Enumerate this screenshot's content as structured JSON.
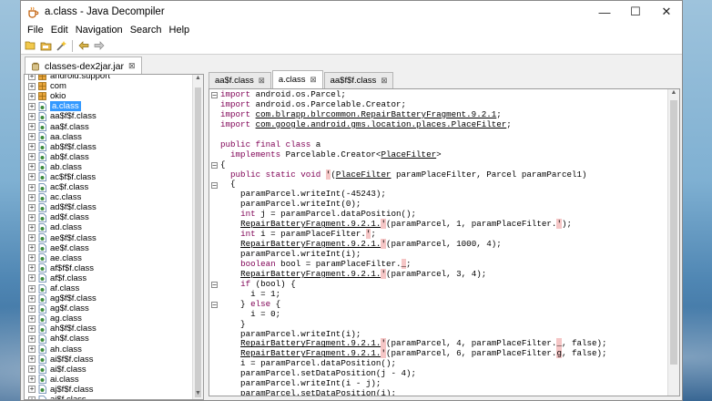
{
  "window": {
    "title": "a.class - Java Decompiler",
    "controls": {
      "minimize": "—",
      "maximize": "☐",
      "close": "✕"
    }
  },
  "menu": [
    "File",
    "Edit",
    "Navigation",
    "Search",
    "Help"
  ],
  "toolbar": {
    "icons": [
      "open-file-icon",
      "save-icon",
      "wand-icon",
      "back-arrow-icon",
      "forward-arrow-icon"
    ]
  },
  "file_tab": {
    "label": "classes-dex2jar.jar",
    "close": "⊠"
  },
  "tree": {
    "items": [
      {
        "label": "android.support",
        "type": "package"
      },
      {
        "label": "com",
        "type": "package"
      },
      {
        "label": "okio",
        "type": "package"
      },
      {
        "label": "a.class",
        "type": "class",
        "selected": true
      },
      {
        "label": "aa$f$f.class",
        "type": "class"
      },
      {
        "label": "aa$f.class",
        "type": "class"
      },
      {
        "label": "aa.class",
        "type": "class"
      },
      {
        "label": "ab$f$f.class",
        "type": "class"
      },
      {
        "label": "ab$f.class",
        "type": "class"
      },
      {
        "label": "ab.class",
        "type": "class"
      },
      {
        "label": "ac$f$f.class",
        "type": "class"
      },
      {
        "label": "ac$f.class",
        "type": "class"
      },
      {
        "label": "ac.class",
        "type": "class"
      },
      {
        "label": "ad$f$f.class",
        "type": "class"
      },
      {
        "label": "ad$f.class",
        "type": "class"
      },
      {
        "label": "ad.class",
        "type": "class"
      },
      {
        "label": "ae$f$f.class",
        "type": "class"
      },
      {
        "label": "ae$f.class",
        "type": "class"
      },
      {
        "label": "ae.class",
        "type": "class"
      },
      {
        "label": "af$f$f.class",
        "type": "class"
      },
      {
        "label": "af$f.class",
        "type": "class"
      },
      {
        "label": "af.class",
        "type": "class"
      },
      {
        "label": "ag$f$f.class",
        "type": "class"
      },
      {
        "label": "ag$f.class",
        "type": "class"
      },
      {
        "label": "ag.class",
        "type": "class"
      },
      {
        "label": "ah$f$f.class",
        "type": "class"
      },
      {
        "label": "ah$f.class",
        "type": "class"
      },
      {
        "label": "ah.class",
        "type": "class"
      },
      {
        "label": "ai$f$f.class",
        "type": "class"
      },
      {
        "label": "ai$f.class",
        "type": "class"
      },
      {
        "label": "ai.class",
        "type": "class"
      },
      {
        "label": "aj$f$f.class",
        "type": "class"
      },
      {
        "label": "aj$f.class",
        "type": "class"
      }
    ]
  },
  "code_tabs": [
    {
      "label": "aa$f.class",
      "active": false
    },
    {
      "label": "a.class",
      "active": true
    },
    {
      "label": "aa$f$f.class",
      "active": false
    }
  ],
  "code_lines": [
    {
      "fold": "−",
      "segments": [
        {
          "t": "import",
          "c": "kw"
        },
        {
          "t": " android.os.Parcel;"
        }
      ]
    },
    {
      "segments": [
        {
          "t": "import",
          "c": "kw"
        },
        {
          "t": " android.os.Parcelable.Creator;"
        }
      ]
    },
    {
      "segments": [
        {
          "t": "import",
          "c": "kw"
        },
        {
          "t": " "
        },
        {
          "t": "com.blrapp.blrcommon.RepairBatteryFragment.9.2.1",
          "c": "ul"
        },
        {
          "t": ";"
        }
      ]
    },
    {
      "segments": [
        {
          "t": "import",
          "c": "kw"
        },
        {
          "t": " "
        },
        {
          "t": "com.google.android.gms.location.places.PlaceFilter",
          "c": "ul"
        },
        {
          "t": ";"
        }
      ]
    },
    {
      "segments": [
        {
          "t": ""
        }
      ]
    },
    {
      "segments": [
        {
          "t": "public final class",
          "c": "kw"
        },
        {
          "t": " a"
        }
      ]
    },
    {
      "segments": [
        {
          "t": "  "
        },
        {
          "t": "implements",
          "c": "kw"
        },
        {
          "t": " Parcelable.Creator<"
        },
        {
          "t": "PlaceFilter",
          "c": "ul"
        },
        {
          "t": ">"
        }
      ]
    },
    {
      "fold": "−",
      "segments": [
        {
          "t": "{"
        }
      ]
    },
    {
      "segments": [
        {
          "t": "  "
        },
        {
          "t": "public static void",
          "c": "kw"
        },
        {
          "t": " "
        },
        {
          "t": "'",
          "c": "hl"
        },
        {
          "t": "("
        },
        {
          "t": "PlaceFilter",
          "c": "ul"
        },
        {
          "t": " paramPlaceFilter, Parcel paramParcel1)"
        }
      ]
    },
    {
      "fold": "−",
      "segments": [
        {
          "t": "  {"
        }
      ]
    },
    {
      "segments": [
        {
          "t": "    paramParcel.writeInt(-45243);"
        }
      ]
    },
    {
      "segments": [
        {
          "t": "    paramParcel.writeInt(0);"
        }
      ]
    },
    {
      "segments": [
        {
          "t": "    "
        },
        {
          "t": "int",
          "c": "kw"
        },
        {
          "t": " j = paramParcel.dataPosition();"
        }
      ]
    },
    {
      "segments": [
        {
          "t": "    "
        },
        {
          "t": "RepairBatteryFragment.9.2.1.",
          "c": "ul"
        },
        {
          "t": "'",
          "c": "hl"
        },
        {
          "t": "(paramParcel, 1, paramPlaceFilter."
        },
        {
          "t": "'",
          "c": "hl"
        },
        {
          "t": ");"
        }
      ]
    },
    {
      "segments": [
        {
          "t": "    "
        },
        {
          "t": "int",
          "c": "kw"
        },
        {
          "t": " i = paramPlaceFilter."
        },
        {
          "t": "'",
          "c": "hl"
        },
        {
          "t": ";"
        }
      ]
    },
    {
      "segments": [
        {
          "t": "    "
        },
        {
          "t": "RepairBatteryFragment.9.2.1.",
          "c": "ul"
        },
        {
          "t": "'",
          "c": "hl"
        },
        {
          "t": "(paramParcel, 1000, 4);"
        }
      ]
    },
    {
      "segments": [
        {
          "t": "    paramParcel.writeInt(i);"
        }
      ]
    },
    {
      "segments": [
        {
          "t": "    "
        },
        {
          "t": "boolean",
          "c": "kw"
        },
        {
          "t": " bool = paramPlaceFilter."
        },
        {
          "t": "_",
          "c": "hl"
        },
        {
          "t": ";"
        }
      ]
    },
    {
      "segments": [
        {
          "t": "    "
        },
        {
          "t": "RepairBatteryFragment.9.2.1.",
          "c": "ul"
        },
        {
          "t": "'",
          "c": "hl"
        },
        {
          "t": "(paramParcel, 3, 4);"
        }
      ]
    },
    {
      "fold": "−",
      "segments": [
        {
          "t": "    "
        },
        {
          "t": "if",
          "c": "kw"
        },
        {
          "t": " (bool) {"
        }
      ]
    },
    {
      "segments": [
        {
          "t": "      i = 1;"
        }
      ]
    },
    {
      "fold": "−",
      "segments": [
        {
          "t": "    } "
        },
        {
          "t": "else",
          "c": "kw"
        },
        {
          "t": " {"
        }
      ]
    },
    {
      "segments": [
        {
          "t": "      i = 0;"
        }
      ]
    },
    {
      "segments": [
        {
          "t": "    }"
        }
      ]
    },
    {
      "segments": [
        {
          "t": "    paramParcel.writeInt(i);"
        }
      ]
    },
    {
      "segments": [
        {
          "t": "    "
        },
        {
          "t": "RepairBatteryFragment.9.2.1.",
          "c": "ul"
        },
        {
          "t": "'",
          "c": "hl"
        },
        {
          "t": "(paramParcel, 4, paramPlaceFilter."
        },
        {
          "t": "_",
          "c": "hl"
        },
        {
          "t": ", false);"
        }
      ]
    },
    {
      "segments": [
        {
          "t": "    "
        },
        {
          "t": "RepairBatteryFragment.9.2.1.",
          "c": "ul"
        },
        {
          "t": "'",
          "c": "hl"
        },
        {
          "t": "(paramParcel, 6, paramPlaceFilter."
        },
        {
          "t": "g",
          "c": "hl"
        },
        {
          "t": ", false);"
        }
      ]
    },
    {
      "segments": [
        {
          "t": "    i = paramParcel.dataPosition();"
        }
      ]
    },
    {
      "segments": [
        {
          "t": "    paramParcel.setDataPosition(j - 4);"
        }
      ]
    },
    {
      "segments": [
        {
          "t": "    paramParcel.writeInt(i - j);"
        }
      ]
    },
    {
      "segments": [
        {
          "t": "    paramParcel.setDataPosition(i);"
        }
      ]
    },
    {
      "segments": [
        {
          "t": "  }"
        }
      ]
    }
  ],
  "colors": {
    "keyword": "#7f0055",
    "selection": "#3399ff",
    "error_highlight": "#f5c6c6"
  }
}
